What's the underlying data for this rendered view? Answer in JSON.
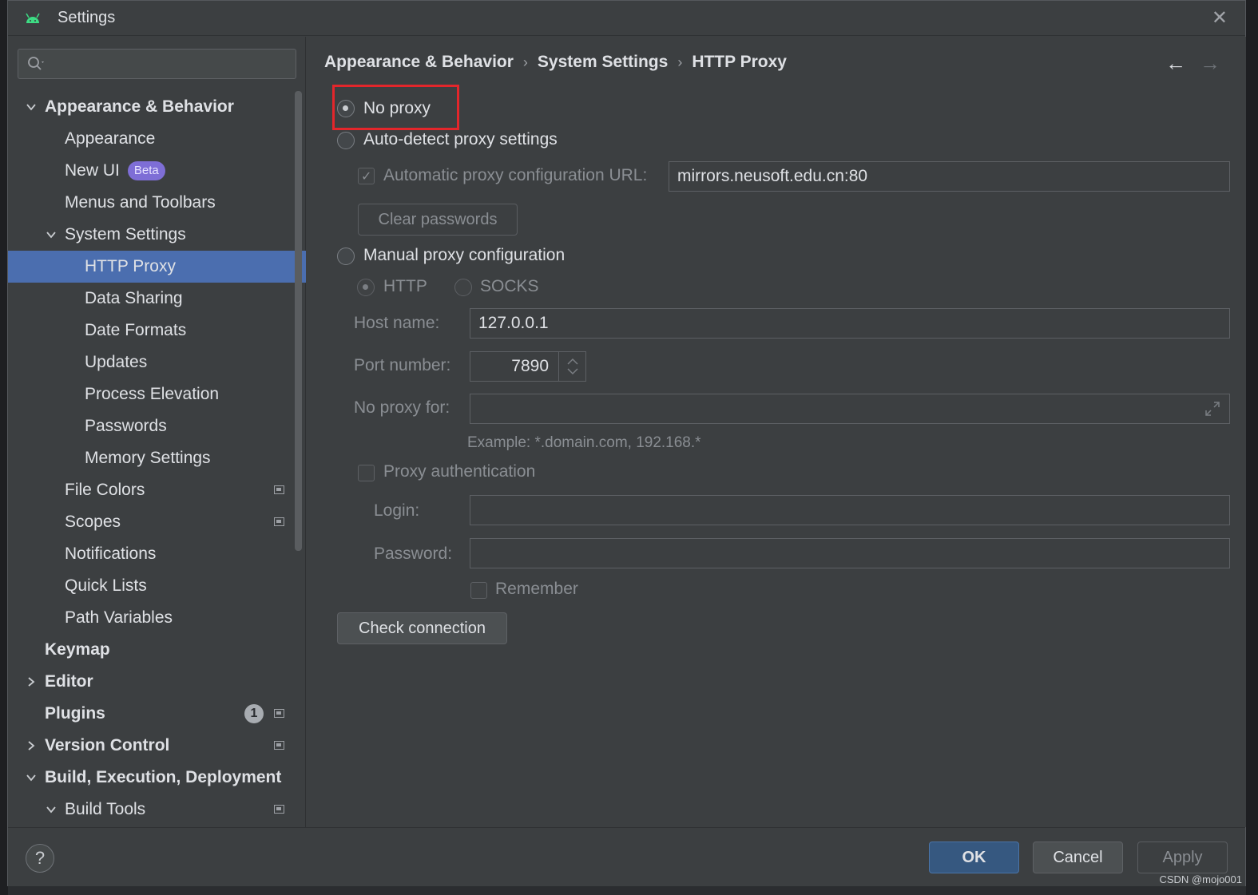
{
  "window": {
    "title": "Settings",
    "close": "✕"
  },
  "search": {
    "placeholder": ""
  },
  "sidebar": {
    "items": [
      {
        "label": "Appearance & Behavior"
      },
      {
        "label": "Appearance"
      },
      {
        "label": "New UI",
        "badge": "Beta"
      },
      {
        "label": "Menus and Toolbars"
      },
      {
        "label": "System Settings"
      },
      {
        "label": "HTTP Proxy"
      },
      {
        "label": "Data Sharing"
      },
      {
        "label": "Date Formats"
      },
      {
        "label": "Updates"
      },
      {
        "label": "Process Elevation"
      },
      {
        "label": "Passwords"
      },
      {
        "label": "Memory Settings"
      },
      {
        "label": "File Colors"
      },
      {
        "label": "Scopes"
      },
      {
        "label": "Notifications"
      },
      {
        "label": "Quick Lists"
      },
      {
        "label": "Path Variables"
      },
      {
        "label": "Keymap"
      },
      {
        "label": "Editor"
      },
      {
        "label": "Plugins",
        "count": "1"
      },
      {
        "label": "Version Control"
      },
      {
        "label": "Build, Execution, Deployment"
      },
      {
        "label": "Build Tools"
      }
    ]
  },
  "breadcrumb": {
    "level1": "Appearance & Behavior",
    "level2": "System Settings",
    "level3": "HTTP Proxy",
    "sep": "›"
  },
  "nav": {
    "back": "←",
    "forward": "→"
  },
  "proxy": {
    "no_proxy": "No proxy",
    "auto_detect": "Auto-detect proxy settings",
    "auto_url_label": "Automatic proxy configuration URL:",
    "auto_url_value": "mirrors.neusoft.edu.cn:80",
    "clear_passwords": "Clear passwords",
    "manual": "Manual proxy configuration",
    "http": "HTTP",
    "socks": "SOCKS",
    "host_label": "Host name:",
    "host_value": "127.0.0.1",
    "port_label": "Port number:",
    "port_value": "7890",
    "no_proxy_for_label": "No proxy for:",
    "no_proxy_for_value": "",
    "example": "Example: *.domain.com, 192.168.*",
    "auth_label": "Proxy authentication",
    "login_label": "Login:",
    "password_label": "Password:",
    "remember_label": "Remember",
    "check_connection": "Check connection"
  },
  "footer": {
    "help": "?",
    "ok": "OK",
    "cancel": "Cancel",
    "apply": "Apply"
  },
  "watermark": "CSDN @mojo001",
  "colors": {
    "selection": "#4b6eaf",
    "highlight_box": "#e3262b",
    "badge": "#7e6ed6"
  }
}
